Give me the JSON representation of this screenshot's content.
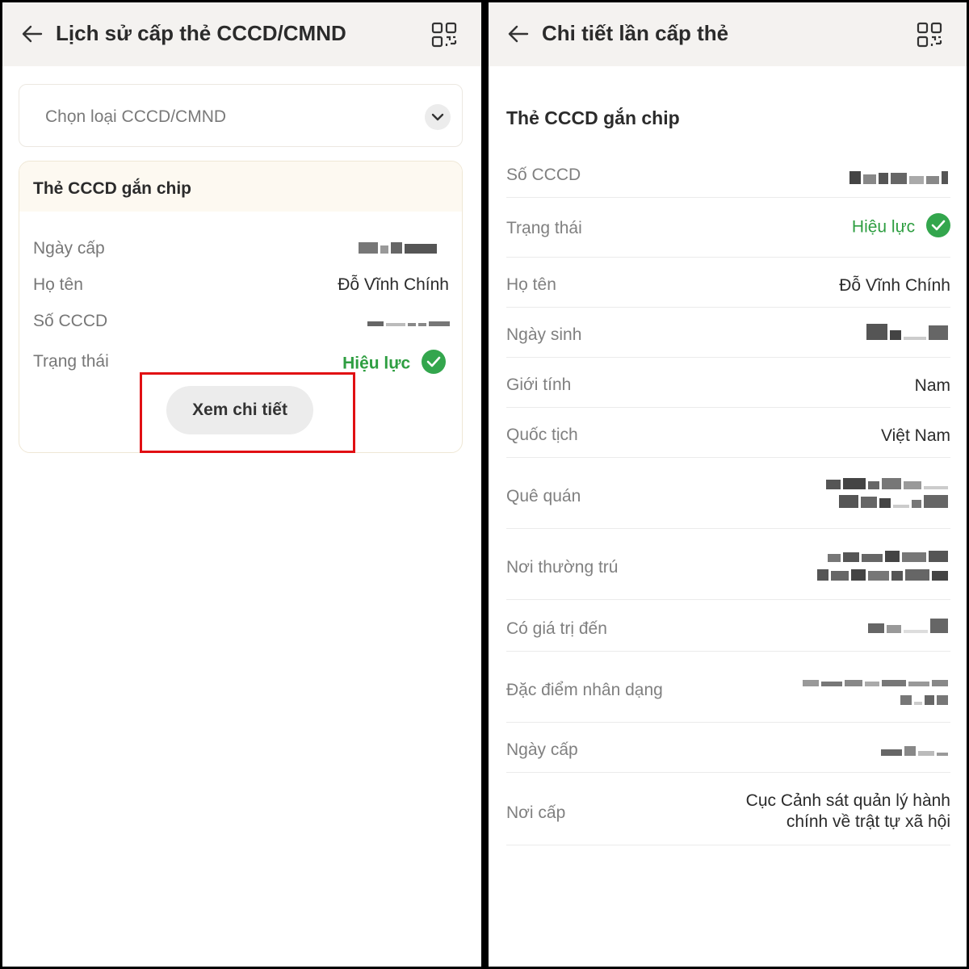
{
  "left_screen": {
    "header": {
      "title": "Lịch sử cấp thẻ CCCD/CMND",
      "back_icon": "arrow-left-icon",
      "qr_icon": "qr-code-icon"
    },
    "select": {
      "placeholder": "Chọn loại CCCD/CMND",
      "icon": "chevron-down-icon"
    },
    "card": {
      "title": "Thẻ CCCD gắn chip",
      "rows": [
        {
          "label": "Ngày cấp",
          "value": ""
        },
        {
          "label": "Họ tên",
          "value": "Đỗ Vĩnh Chính"
        },
        {
          "label": "Số CCCD",
          "value": ""
        },
        {
          "label": "Trạng thái",
          "value": "Hiệu lực"
        }
      ],
      "detail_button": "Xem chi tiết"
    },
    "highlight_color": "#e10f13"
  },
  "right_screen": {
    "header": {
      "title": "Chi tiết lần cấp thẻ",
      "back_icon": "arrow-left-icon",
      "qr_icon": "qr-code-icon"
    },
    "section_title": "Thẻ CCCD gắn chip",
    "rows": [
      {
        "label": "Số CCCD",
        "value": ""
      },
      {
        "label": "Trạng thái",
        "value": "Hiệu lực"
      },
      {
        "label": "Họ tên",
        "value": "Đỗ Vĩnh Chính"
      },
      {
        "label": "Ngày sinh",
        "value": ""
      },
      {
        "label": "Giới tính",
        "value": "Nam"
      },
      {
        "label": "Quốc tịch",
        "value": "Việt Nam"
      },
      {
        "label": "Quê quán",
        "value": ""
      },
      {
        "label": "Nơi thường trú",
        "value": ""
      },
      {
        "label": "Có giá trị đến",
        "value": ""
      },
      {
        "label": "Đặc điểm nhân dạng",
        "value": ""
      },
      {
        "label": "Ngày cấp",
        "value": ""
      },
      {
        "label": "Nơi cấp",
        "value_line1": "Cục Cảnh sát quản lý hành",
        "value_line2": "chính về trật tự xã hội"
      }
    ]
  },
  "colors": {
    "header_bg": "#f4f2f0",
    "status_green": "#2e9e41",
    "accent_border": "#efe7d5"
  }
}
